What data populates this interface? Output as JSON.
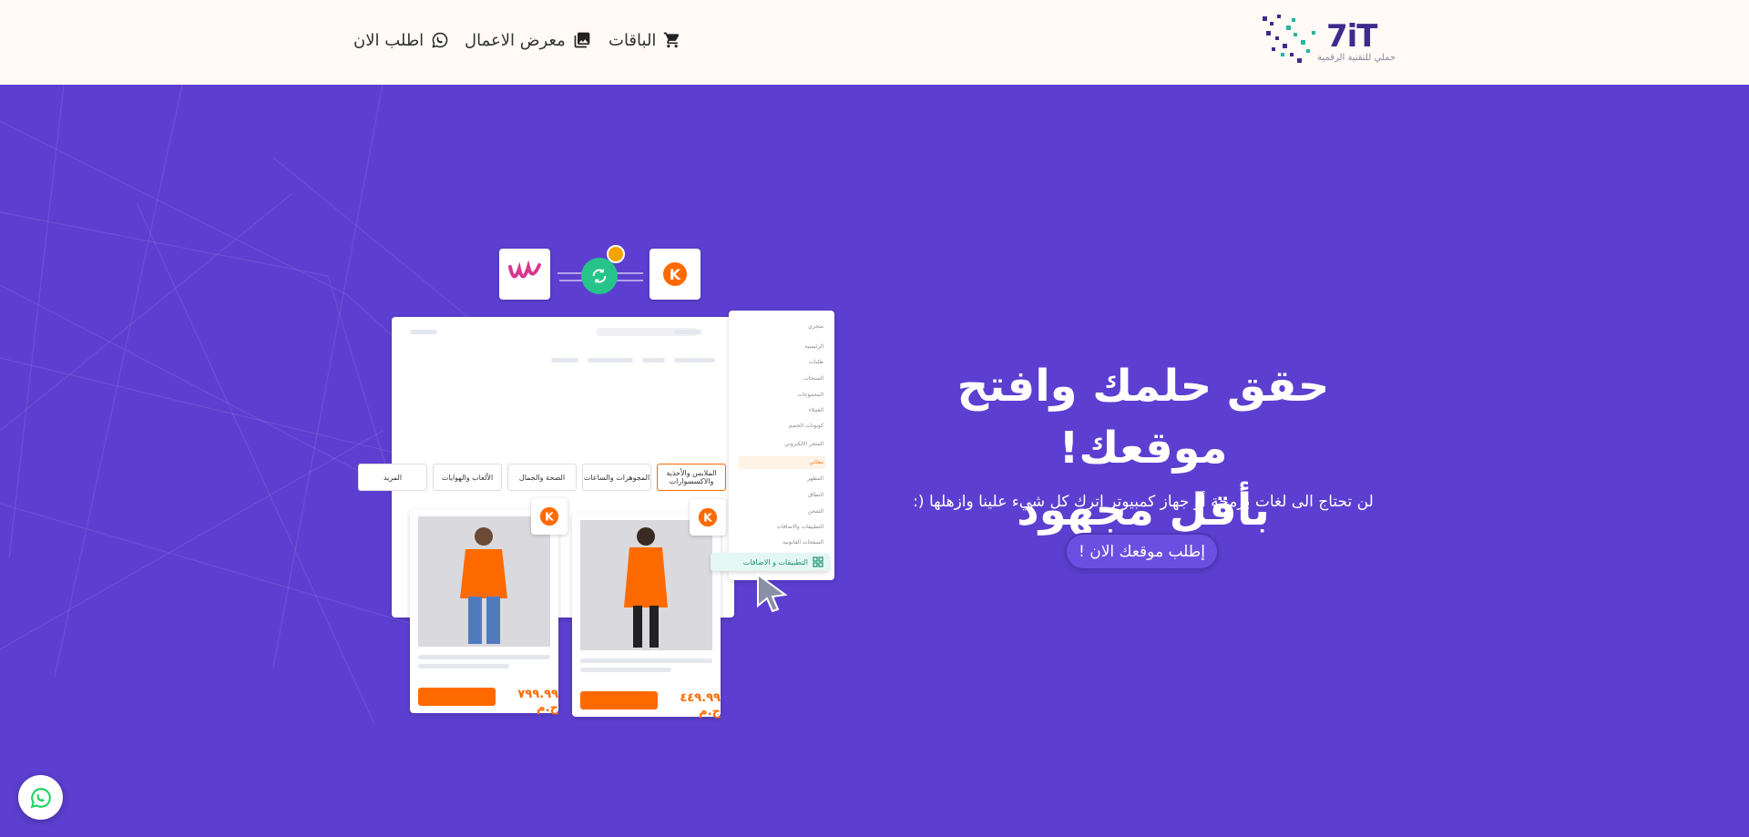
{
  "header": {
    "logo_text": "7iT",
    "logo_tagline": "حملي للتقنية الرقمية",
    "nav": [
      {
        "label": "الباقات",
        "icon": "cart-icon"
      },
      {
        "label": "معرض الاعمال",
        "icon": "gallery-icon"
      },
      {
        "label": "اطلب الان",
        "icon": "whatsapp-icon"
      }
    ]
  },
  "hero": {
    "title_line1": "حقق حلمك وافتح موقعك!",
    "title_line2": "بأقل مجهود",
    "subtitle": "لن تحتاج الى لغات برمجة أو جهاز كمبيوتر إترك كل شيء علينا وازهلها (:",
    "cta_label": "إطلب موقعك الان !"
  },
  "mockup": {
    "categories": [
      "الملابس والأحذية والاكسسوارات",
      "المجوهرات والساعات",
      "الصحة والجمال",
      "الألعاب والهوايات",
      "المزيد"
    ],
    "sidebar_top": "متجري",
    "sidebar_items": [
      "الرئيسية",
      "طلبات",
      "المنتجات",
      "المجموعات",
      "العملاء",
      "كوبونات الخصم"
    ],
    "sidebar_section": "المتجر الالكتروني",
    "sidebar_items2": [
      "مجاني",
      "المظهر",
      "النطاق",
      "الشحن",
      "التطبيقات والاضافات",
      "الصفحات القانونية"
    ],
    "sidebar_highlight": "التطبيقات و الاضافات",
    "prices": [
      "٧٩٩.٩٩",
      "٤٤٩.٩٩"
    ],
    "currency": "ج.م"
  },
  "colors": {
    "hero_bg": "#5c3fd0",
    "accent": "#ff6a00",
    "header_bg": "#fffaf5",
    "whatsapp": "#25d366"
  }
}
